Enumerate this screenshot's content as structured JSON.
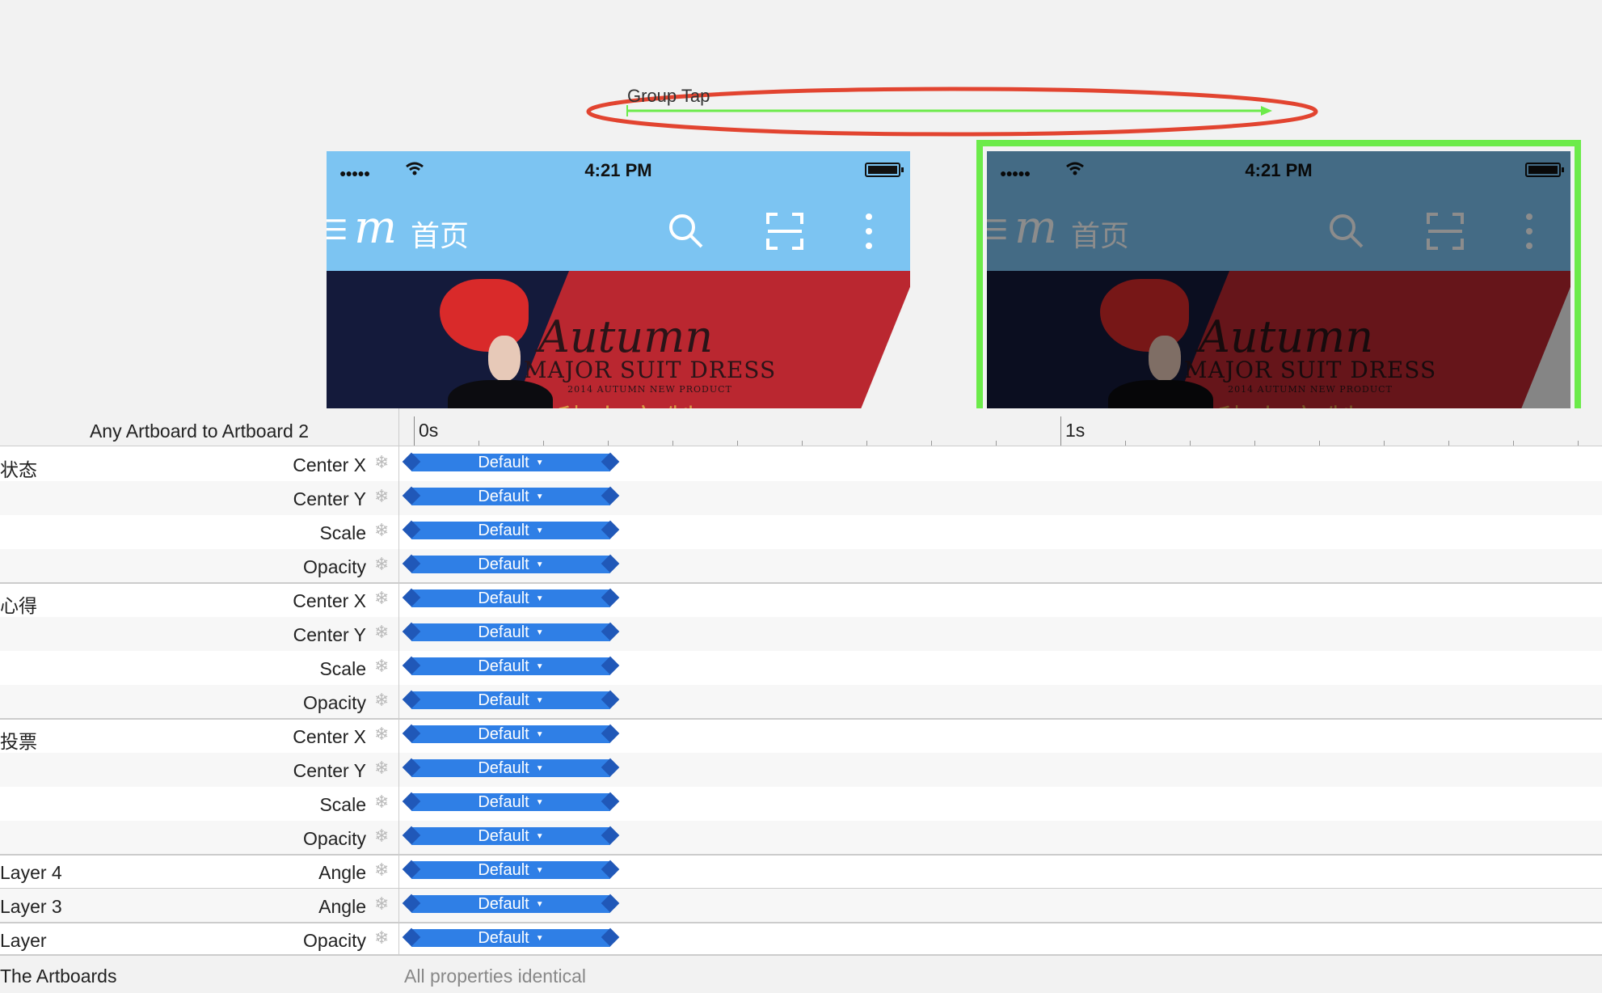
{
  "canvas": {
    "connection_label": "Group Tap",
    "colors": {
      "highlight_outline": "#6ceb4a",
      "annotation_circle": "#e24430",
      "connection_arrow": "#6ceb4a",
      "navbar_blue": "#7cc4f2"
    },
    "artboard_1": {
      "status_signal": "●●●●●",
      "status_time": "4:21 PM",
      "nav_menu_icon": "menu-icon",
      "nav_logo": "m",
      "nav_title": "首页",
      "nav_icons": [
        "search-icon",
        "scan-icon",
        "more-vertical-icon"
      ],
      "banner_line_1": "Autumn",
      "banner_line_2": "MAJOR SUIT DRESS",
      "banner_line_3": "2014 AUTUMN NEW PRODUCT",
      "banner_line_4": "秋 人 定 制"
    },
    "artboard_2": {
      "status_signal": "●●●●●",
      "status_time": "4:21 PM",
      "nav_logo": "m",
      "nav_title": "首页",
      "banner_line_1": "Autumn",
      "banner_line_2": "MAJOR SUIT DRESS",
      "banner_line_3": "2014 AUTUMN NEW PRODUCT",
      "banner_line_4": "秋 人 定 制"
    }
  },
  "timeline": {
    "title": "Any Artboard to Artboard 2",
    "ticks": [
      "0s",
      "1s"
    ],
    "bar_label": "Default",
    "freeze_icon": "snowflake-icon",
    "rows": [
      {
        "group": "状态",
        "property": "Center X"
      },
      {
        "group": "",
        "property": "Center Y"
      },
      {
        "group": "",
        "property": "Scale"
      },
      {
        "group": "",
        "property": "Opacity"
      },
      {
        "group": "心得",
        "property": "Center X"
      },
      {
        "group": "",
        "property": "Center Y"
      },
      {
        "group": "",
        "property": "Scale"
      },
      {
        "group": "",
        "property": "Opacity"
      },
      {
        "group": "投票",
        "property": "Center X"
      },
      {
        "group": "",
        "property": "Center Y"
      },
      {
        "group": "",
        "property": "Scale"
      },
      {
        "group": "",
        "property": "Opacity"
      },
      {
        "group": "Layer 4",
        "property": "Angle"
      },
      {
        "group": "Layer 3",
        "property": "Angle"
      },
      {
        "group": "Layer",
        "property": "Opacity"
      }
    ],
    "artboards_label": "The Artboards",
    "artboards_status": "All properties identical"
  }
}
